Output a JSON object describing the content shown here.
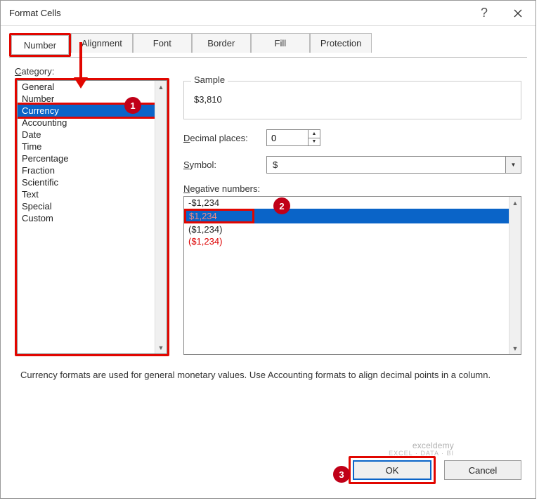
{
  "titlebar": {
    "title": "Format Cells"
  },
  "tabs": {
    "items": [
      {
        "label": "Number"
      },
      {
        "label": "Alignment"
      },
      {
        "label": "Font"
      },
      {
        "label": "Border"
      },
      {
        "label": "Fill"
      },
      {
        "label": "Protection"
      }
    ]
  },
  "category": {
    "label_pre": "C",
    "label_rest": "ategory:",
    "items": [
      "General",
      "Number",
      "Currency",
      "Accounting",
      "Date",
      "Time",
      "Percentage",
      "Fraction",
      "Scientific",
      "Text",
      "Special",
      "Custom"
    ],
    "selected_index": 2
  },
  "sample": {
    "legend": "Sample",
    "value": "$3,810"
  },
  "decimal": {
    "label_pre": "D",
    "label_rest": "ecimal places:",
    "value": "0"
  },
  "symbol": {
    "label_pre": "S",
    "label_rest": "ymbol:",
    "value": "$"
  },
  "negative": {
    "label_pre": "N",
    "label_rest": "egative numbers:",
    "items": [
      {
        "text": "-$1,234",
        "color": "black"
      },
      {
        "text": "$1,234",
        "color": "red",
        "selected": true
      },
      {
        "text": "($1,234)",
        "color": "black"
      },
      {
        "text": "($1,234)",
        "color": "red"
      }
    ]
  },
  "description": "Currency formats are used for general monetary values.  Use Accounting formats to align decimal points in a column.",
  "footer": {
    "ok": "OK",
    "cancel": "Cancel"
  },
  "annotations": {
    "b1": "1",
    "b2": "2",
    "b3": "3"
  },
  "watermark": {
    "main": "exceldemy",
    "sub": "EXCEL · DATA · BI"
  }
}
